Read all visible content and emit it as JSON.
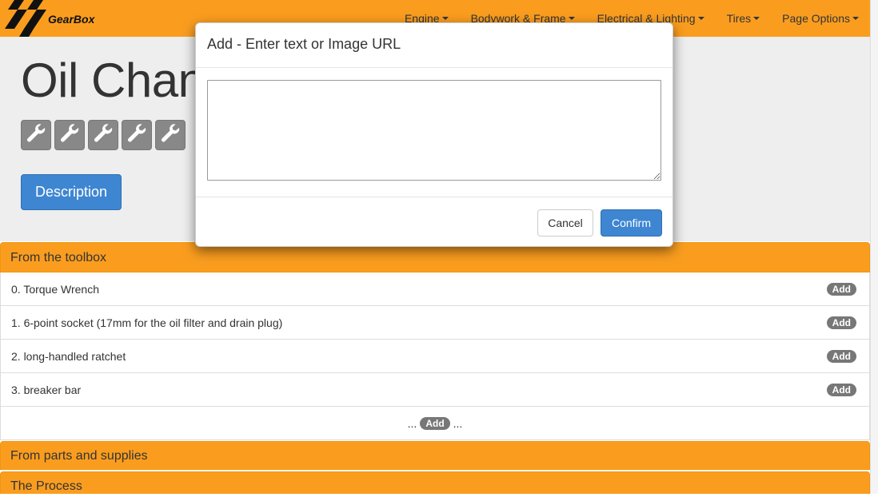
{
  "brand": {
    "name": "GearBox",
    "logo_icon": "checkered-flag-icon"
  },
  "nav": {
    "items": [
      {
        "label": "Engine"
      },
      {
        "label": "Bodywork & Frame"
      },
      {
        "label": "Electrical & Lighting"
      },
      {
        "label": "Tires"
      },
      {
        "label": "Page Options"
      }
    ]
  },
  "page": {
    "title": "Oil Change",
    "rating_icon": "wrench-icon",
    "rating_count": 5,
    "description_button": "Description"
  },
  "toolbox": {
    "heading": "From the toolbox",
    "items": [
      {
        "label": "0. Torque Wrench",
        "action": "Add"
      },
      {
        "label": "1. 6-point socket (17mm for the oil filter and drain plug)",
        "action": "Add"
      },
      {
        "label": "2. long-handled ratchet",
        "action": "Add"
      },
      {
        "label": "3. breaker bar",
        "action": "Add"
      }
    ],
    "add_row": {
      "prefix": "...",
      "action": "Add",
      "suffix": "..."
    }
  },
  "parts": {
    "heading": "From parts and supplies"
  },
  "process": {
    "heading": "The Process"
  },
  "modal": {
    "title": "Add - Enter text or Image URL",
    "text_value": "",
    "cancel_label": "Cancel",
    "confirm_label": "Confirm"
  },
  "colors": {
    "accent": "#fa9d1f",
    "primary": "#3e86d2",
    "badge": "#777777",
    "jumbotron": "#eeeeee"
  }
}
